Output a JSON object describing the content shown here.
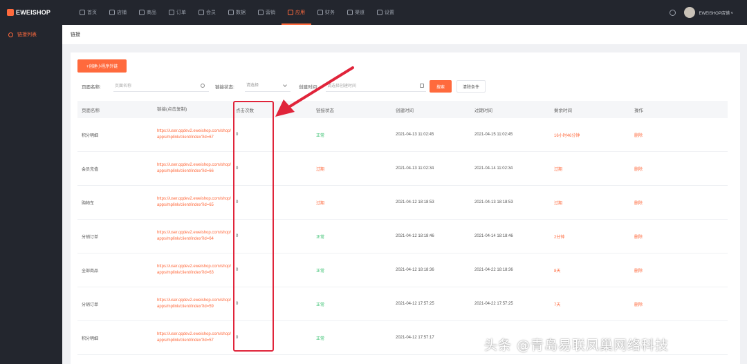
{
  "brand": {
    "name": "EWEISHOP",
    "accent": "#ff6a3d"
  },
  "nav": [
    {
      "label": "首页",
      "icon": "home-icon",
      "active": false
    },
    {
      "label": "店铺",
      "icon": "store-icon",
      "active": false
    },
    {
      "label": "商品",
      "icon": "goods-icon",
      "active": false
    },
    {
      "label": "订单",
      "icon": "order-icon",
      "active": false
    },
    {
      "label": "会员",
      "icon": "member-icon",
      "active": false
    },
    {
      "label": "数据",
      "icon": "data-icon",
      "active": false
    },
    {
      "label": "营销",
      "icon": "tag-icon",
      "active": false
    },
    {
      "label": "应用",
      "icon": "app-icon",
      "active": true
    },
    {
      "label": "财务",
      "icon": "finance-icon",
      "active": false
    },
    {
      "label": "渠道",
      "icon": "channel-icon",
      "active": false
    },
    {
      "label": "设置",
      "icon": "gear-icon",
      "active": false
    }
  ],
  "user": {
    "name": "EWEISHOP店铺 ˅"
  },
  "sidebar": {
    "items": [
      {
        "label": "链接列表",
        "icon": "link-icon"
      }
    ]
  },
  "breadcrumb": "链接",
  "toolbar": {
    "create_label": "+创建小程序外链"
  },
  "filters": {
    "page_name_label": "页面名称:",
    "page_name_placeholder": "页面名称",
    "status_label": "链接状态:",
    "status_value": "请选择",
    "created_label": "创建时间:",
    "created_placeholder": "请选择创建时间",
    "search_label": "搜索",
    "clear_label": "清除条件"
  },
  "table": {
    "headers": [
      "页面名称",
      "链接(点击复制)",
      "点击次数",
      "链接状态",
      "创建时间",
      "过期时间",
      "剩余时间",
      "操作"
    ],
    "rows": [
      {
        "name": "积分明细",
        "link": "https://user.qqdev2.eweishop.com/shop/apps/mplink/client/index?id=67",
        "clicks": "0",
        "status": "正常",
        "status_ok": true,
        "created": "2021-04-13 11:02:45",
        "expires": "2021-04-15 11:02:45",
        "remaining": "16小时46分钟",
        "action": "删除"
      },
      {
        "name": "会员充值",
        "link": "https://user.qqdev2.eweishop.com/shop/apps/mplink/client/index?id=66",
        "clicks": "0",
        "status": "过期",
        "status_ok": false,
        "created": "2021-04-13 11:02:34",
        "expires": "2021-04-14 11:02:34",
        "remaining": "过期",
        "action": "删除"
      },
      {
        "name": "购物车",
        "link": "https://user.qqdev2.eweishop.com/shop/apps/mplink/client/index?id=65",
        "clicks": "0",
        "status": "过期",
        "status_ok": false,
        "created": "2021-04-12 18:18:53",
        "expires": "2021-04-13 18:18:53",
        "remaining": "过期",
        "action": "删除"
      },
      {
        "name": "分销订单",
        "link": "https://user.qqdev2.eweishop.com/shop/apps/mplink/client/index?id=64",
        "clicks": "0",
        "status": "正常",
        "status_ok": true,
        "created": "2021-04-12 18:18:46",
        "expires": "2021-04-14 18:18:46",
        "remaining": "2分钟",
        "action": "删除"
      },
      {
        "name": "全部商品",
        "link": "https://user.qqdev2.eweishop.com/shop/apps/mplink/client/index?id=63",
        "clicks": "0",
        "status": "正常",
        "status_ok": true,
        "created": "2021-04-12 18:18:36",
        "expires": "2021-04-22 18:18:36",
        "remaining": "8天",
        "action": "删除"
      },
      {
        "name": "分销订单",
        "link": "https://user.qqdev2.eweishop.com/shop/apps/mplink/client/index?id=59",
        "clicks": "0",
        "status": "正常",
        "status_ok": true,
        "created": "2021-04-12 17:57:25",
        "expires": "2021-04-22 17:57:25",
        "remaining": "7天",
        "action": "删除"
      },
      {
        "name": "积分明细",
        "link": "https://user.qqdev2.eweishop.com/shop/apps/mplink/client/index?id=57",
        "clicks": "0",
        "status": "正常",
        "status_ok": true,
        "created": "2021-04-12 17:57:17",
        "expires": "",
        "remaining": "",
        "action": ""
      }
    ]
  },
  "annotation": {
    "box_color": "#e0243a"
  },
  "watermark": "头条 @青岛易联凤巢网络科技"
}
